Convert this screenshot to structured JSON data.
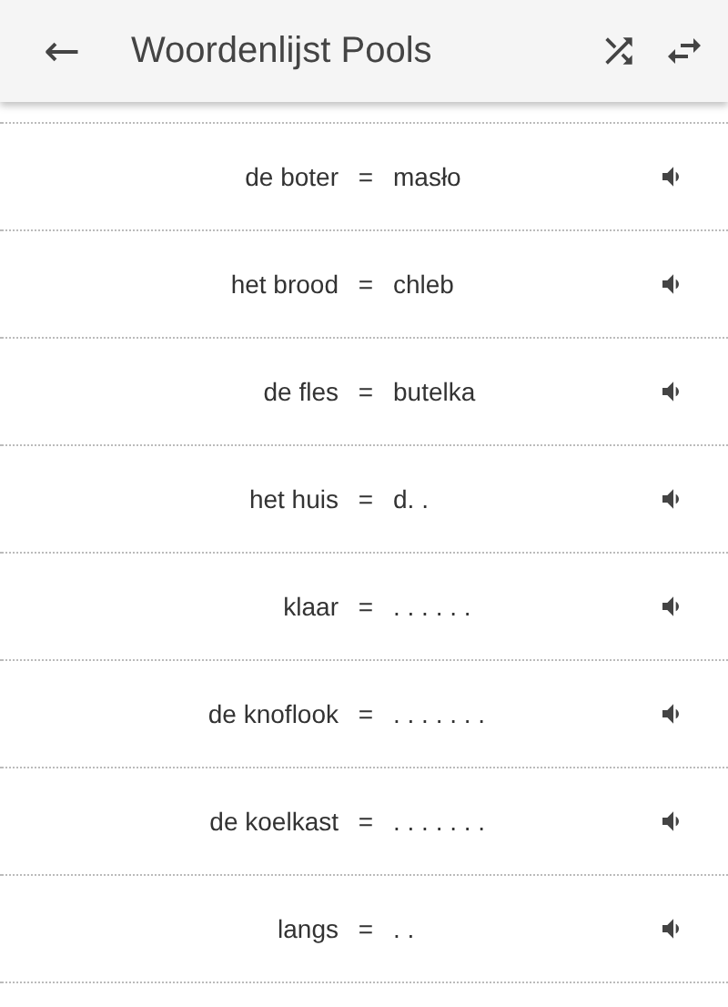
{
  "app_bar": {
    "back": "←",
    "title": "Woordenlijst Pools"
  },
  "words": [
    {
      "dutch": "de boter",
      "separator": "=",
      "polish": "masło"
    },
    {
      "dutch": "het brood",
      "separator": "=",
      "polish": "chleb"
    },
    {
      "dutch": "de fles",
      "separator": "=",
      "polish": "butelka"
    },
    {
      "dutch": "het huis",
      "separator": "=",
      "polish": "d. ."
    },
    {
      "dutch": "klaar",
      "separator": "=",
      "polish": ". . . . . ."
    },
    {
      "dutch": "de knoflook",
      "separator": "=",
      "polish": ". . . . . . ."
    },
    {
      "dutch": "de koelkast",
      "separator": "=",
      "polish": ". . . . . . ."
    },
    {
      "dutch": "langs",
      "separator": "=",
      "polish": ". ."
    }
  ]
}
